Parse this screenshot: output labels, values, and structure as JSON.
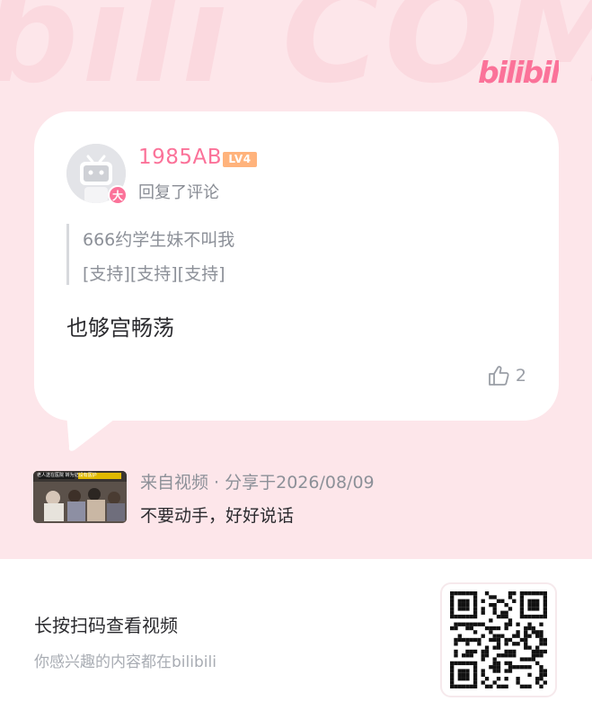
{
  "brand": {
    "logo_text": "bilibili",
    "watermark_text": "bili COMMENT",
    "accent_color": "#fb7299"
  },
  "comment_card": {
    "user": {
      "name": "1985AB",
      "level": "LV4",
      "badge": "大",
      "avatar_icon": "tv-mascot-avatar-icon"
    },
    "action": "回复了评论",
    "quoted": {
      "line1": "666约学生妹不叫我",
      "line2": "[支持][支持][支持]"
    },
    "text": "也够宫畅荡",
    "likes": "2",
    "like_icon": "thumbs-up-icon"
  },
  "video": {
    "meta": "来自视频 · 分享于2026/08/09",
    "title": "不要动手，好好说话",
    "thumbnail_caption": "老人送在医院 转为记设有医护"
  },
  "footer": {
    "title": "长按扫码查看视频",
    "subtitle": "你感兴趣的内容都在bilibili",
    "qr_icon": "qr-code-icon"
  }
}
